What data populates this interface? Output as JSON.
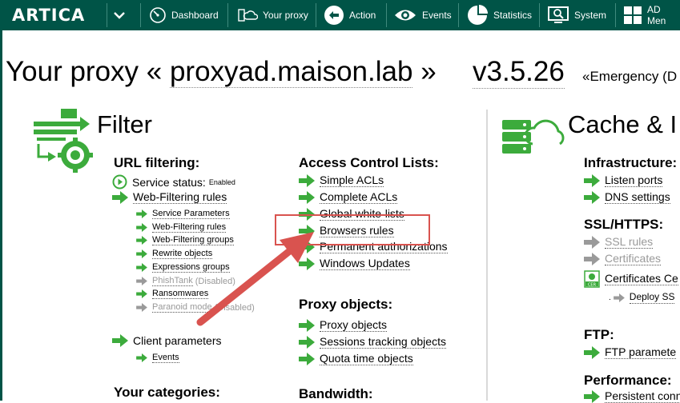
{
  "app": {
    "logo": "ARTICA"
  },
  "nav": {
    "items": [
      {
        "label": "Dashboard"
      },
      {
        "label": "Your proxy"
      },
      {
        "label": "Action"
      },
      {
        "label": "Events"
      },
      {
        "label": "Statistics"
      },
      {
        "label": "System"
      },
      {
        "label": "AD Men"
      }
    ]
  },
  "title": {
    "prefix": "Your proxy «",
    "hostname": "proxyad.maison.lab",
    "suffix": "»",
    "version": "v3.5.26",
    "emergency": "«Emergency (D"
  },
  "filter": {
    "title": "Filter",
    "url_filtering": {
      "heading": "URL filtering:",
      "service_status_label": "Service status:",
      "service_status_value": "Enabled",
      "web_filtering_rules": "Web-Filtering rules",
      "sub_items": [
        {
          "label": "Service Parameters"
        },
        {
          "label": "Web-Filtering rules"
        },
        {
          "label": "Web-Filtering groups"
        },
        {
          "label": "Rewrite objects"
        },
        {
          "label": "Expressions groups"
        },
        {
          "label": "PhishTank",
          "status": "(Disabled)"
        },
        {
          "label": "Ransomwares"
        },
        {
          "label": "Paranoid mode",
          "status": "(Disabled)"
        }
      ],
      "client_parameters": "Client parameters",
      "client_sub": [
        {
          "label": "Events"
        }
      ]
    },
    "your_categories": {
      "heading": "Your categories:"
    },
    "acl": {
      "heading": "Access Control Lists:",
      "items": [
        {
          "label": "Simple ACLs"
        },
        {
          "label": "Complete ACLs"
        },
        {
          "label": "Global white-lists"
        },
        {
          "label": "Browsers rules"
        },
        {
          "label": "Permanent authorizations"
        },
        {
          "label": "Windows Updates"
        }
      ]
    },
    "proxy_objects": {
      "heading": "Proxy objects:",
      "items": [
        {
          "label": "Proxy objects"
        },
        {
          "label": "Sessions tracking objects"
        },
        {
          "label": "Quota time objects"
        }
      ]
    },
    "bandwidth": {
      "heading": "Bandwidth:"
    }
  },
  "cache": {
    "title": "Cache & I",
    "infrastructure": {
      "heading": "Infrastructure:",
      "items": [
        {
          "label": "Listen ports"
        },
        {
          "label": "DNS settings"
        }
      ]
    },
    "ssl": {
      "heading": "SSL/HTTPS:",
      "items": [
        {
          "label": "SSL rules"
        },
        {
          "label": "Certificates"
        },
        {
          "label": "Certificates Ce"
        }
      ],
      "sub": [
        {
          "label": "Deploy SS"
        }
      ]
    },
    "ftp": {
      "heading": "FTP:",
      "items": [
        {
          "label": "FTP paramete"
        }
      ]
    },
    "performance": {
      "heading": "Performance:",
      "items": [
        {
          "label": "Persistent conn"
        }
      ]
    }
  },
  "colors": {
    "topbar": "#005447",
    "arrow_green": "#3cab3c",
    "annotation_red": "#d9534f"
  }
}
